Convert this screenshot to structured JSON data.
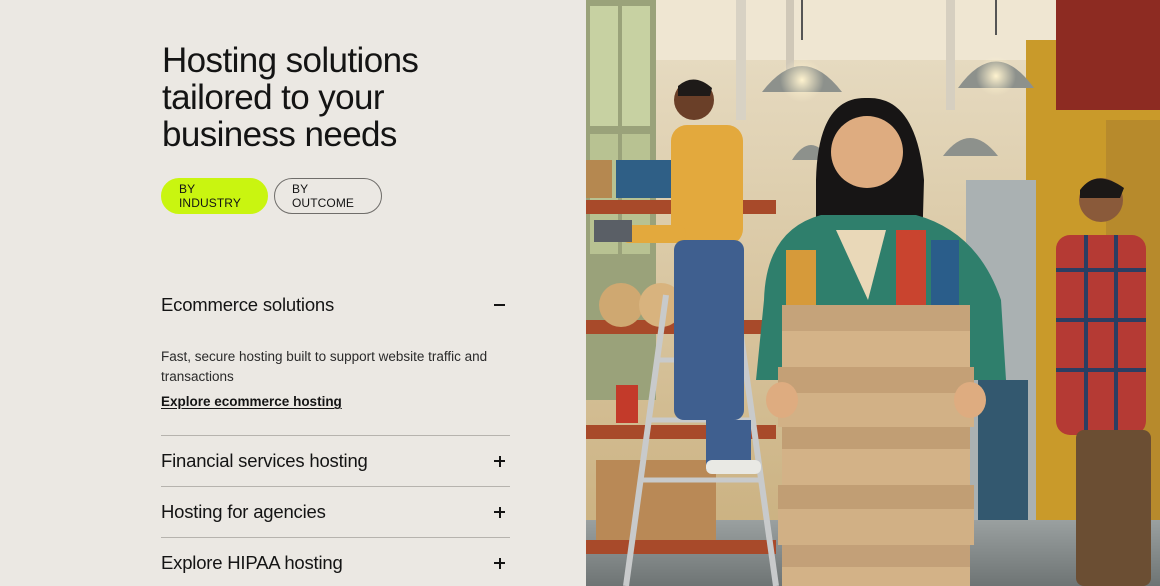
{
  "hero": {
    "title_line1": "Hosting solutions",
    "title_line2": "tailored to your",
    "title_line3": "business needs"
  },
  "filters": {
    "by_industry": "BY INDUSTRY",
    "by_outcome": "BY OUTCOME"
  },
  "accordion": {
    "items": [
      {
        "title": "Ecommerce solutions",
        "expanded": true,
        "description": "Fast, secure hosting built to support website traffic and transactions",
        "link": "Explore ecommerce hosting"
      },
      {
        "title": "Financial services hosting",
        "expanded": false
      },
      {
        "title": "Hosting for agencies",
        "expanded": false
      },
      {
        "title": "Explore HIPAA hosting",
        "expanded": false
      }
    ]
  },
  "colors": {
    "accent": "#c9f510",
    "background": "#ebe8e3",
    "text": "#141414"
  }
}
